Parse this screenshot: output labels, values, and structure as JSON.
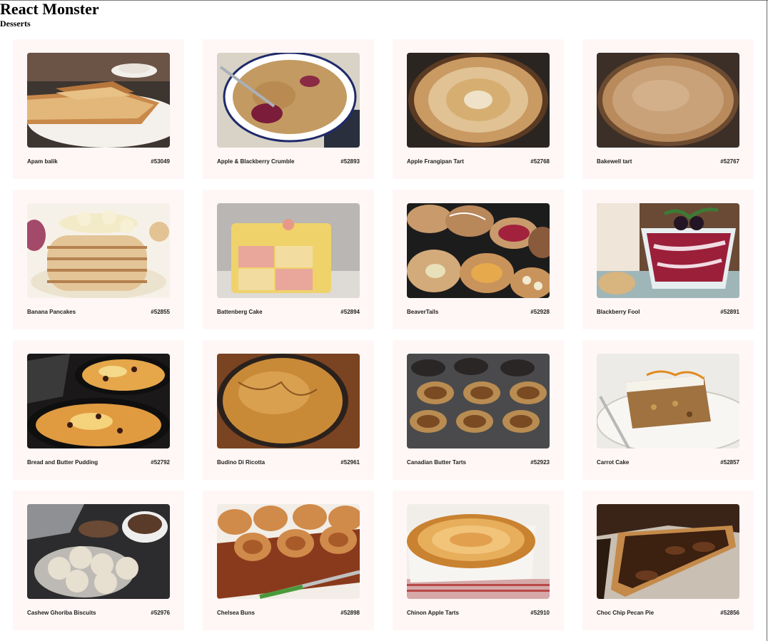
{
  "app": {
    "title": "React Monster"
  },
  "section": {
    "title": "Desserts"
  },
  "meals": [
    {
      "name": "Apam balik",
      "id": "#53049",
      "image": "layered pancake on plate"
    },
    {
      "name": "Apple & Blackberry Crumble",
      "id": "#52893",
      "image": "crumble in enamel dish"
    },
    {
      "name": "Apple Frangipan Tart",
      "id": "#52768",
      "image": "round apple tart"
    },
    {
      "name": "Bakewell tart",
      "id": "#52767",
      "image": "almond topped tart"
    },
    {
      "name": "Banana Pancakes",
      "id": "#52855",
      "image": "pancake stack with banana"
    },
    {
      "name": "Battenberg Cake",
      "id": "#52894",
      "image": "checkered marzipan cake"
    },
    {
      "name": "BeaverTails",
      "id": "#52928",
      "image": "topped pastries on tray"
    },
    {
      "name": "Blackberry Fool",
      "id": "#52891",
      "image": "berry dessert in glass"
    },
    {
      "name": "Bread and Butter Pudding",
      "id": "#52792",
      "image": "baked pudding in pans"
    },
    {
      "name": "Budino Di Ricotta",
      "id": "#52961",
      "image": "golden baked ricotta cake"
    },
    {
      "name": "Canadian Butter Tarts",
      "id": "#52923",
      "image": "tarts in muffin tin"
    },
    {
      "name": "Carrot Cake",
      "id": "#52857",
      "image": "carrot cake slice"
    },
    {
      "name": "Cashew Ghoriba Biscuits",
      "id": "#52976",
      "image": "sugared biscuits with tea"
    },
    {
      "name": "Chelsea Buns",
      "id": "#52898",
      "image": "glazed buns on board"
    },
    {
      "name": "Chinon Apple Tarts",
      "id": "#52910",
      "image": "apple tart in white dish"
    },
    {
      "name": "Choc Chip Pecan Pie",
      "id": "#52856",
      "image": "pecan pie slices"
    }
  ]
}
